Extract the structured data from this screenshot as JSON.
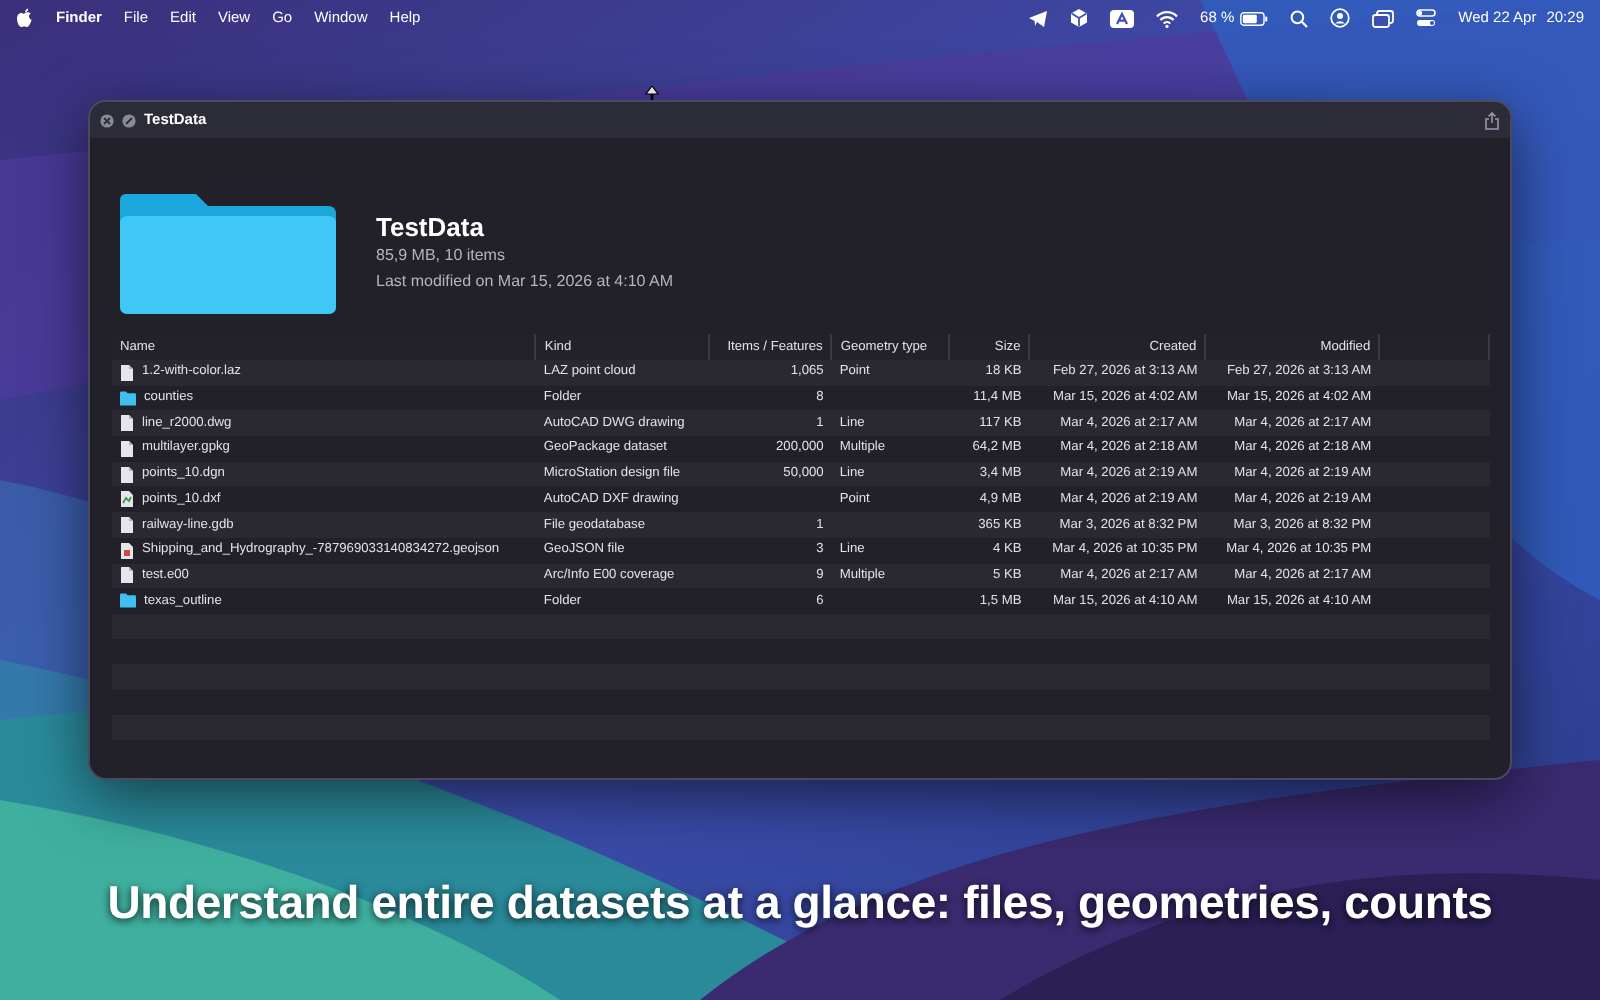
{
  "menu_bar": {
    "app": "Finder",
    "menus": [
      "File",
      "Edit",
      "View",
      "Go",
      "Window",
      "Help"
    ],
    "battery": "68 %",
    "date": "Wed 22 Apr",
    "time": "20:29"
  },
  "window": {
    "title": "TestData"
  },
  "header": {
    "title": "TestData",
    "summary": "85,9 MB, 10 items",
    "modified": "Last modified on Mar 15, 2026 at 4:10 AM"
  },
  "table": {
    "columns": [
      "Name",
      "Kind",
      "Items / Features",
      "Geometry type",
      "Size",
      "Created",
      "Modified"
    ],
    "rows": [
      {
        "kind": "file",
        "name": "1.2-with-color.laz",
        "type": "LAZ point cloud",
        "items": "1,065",
        "geometry": "Point",
        "size": "18 KB",
        "created": "Feb 27, 2026 at 3:13 AM",
        "modified": "Feb 27, 2026 at 3:13 AM"
      },
      {
        "kind": "folder",
        "name": "counties",
        "type": "Folder",
        "items": "8",
        "geometry": "",
        "size": "11,4 MB",
        "created": "Mar 15, 2026 at 4:02 AM",
        "modified": "Mar 15, 2026 at 4:02 AM"
      },
      {
        "kind": "file",
        "name": "line_r2000.dwg",
        "type": "AutoCAD DWG drawing",
        "items": "1",
        "geometry": "Line",
        "size": "117 KB",
        "created": "Mar 4, 2026 at 2:17 AM",
        "modified": "Mar 4, 2026 at 2:17 AM"
      },
      {
        "kind": "file",
        "name": "multilayer.gpkg",
        "type": "GeoPackage dataset",
        "items": "200,000",
        "geometry": "Multiple",
        "size": "64,2 MB",
        "created": "Mar 4, 2026 at 2:18 AM",
        "modified": "Mar 4, 2026 at 2:18 AM"
      },
      {
        "kind": "file",
        "name": "points_10.dgn",
        "type": "MicroStation design file",
        "items": "50,000",
        "geometry": "Line",
        "size": "3,4 MB",
        "created": "Mar 4, 2026 at 2:19 AM",
        "modified": "Mar 4, 2026 at 2:19 AM"
      },
      {
        "kind": "drawing",
        "name": "points_10.dxf",
        "type": "AutoCAD DXF drawing",
        "items": "",
        "geometry": "Point",
        "size": "4,9 MB",
        "created": "Mar 4, 2026 at 2:19 AM",
        "modified": "Mar 4, 2026 at 2:19 AM"
      },
      {
        "kind": "file",
        "name": "railway-line.gdb",
        "type": "File geodatabase",
        "items": "1",
        "geometry": "",
        "size": "365 KB",
        "created": "Mar 3, 2026 at 8:32 PM",
        "modified": "Mar 3, 2026 at 8:32 PM"
      },
      {
        "kind": "json",
        "name": "Shipping_and_Hydrography_-787969033140834272.geojson",
        "type": "GeoJSON file",
        "items": "3",
        "geometry": "Line",
        "size": "4 KB",
        "created": "Mar 4, 2026 at 10:35 PM",
        "modified": "Mar 4, 2026 at 10:35 PM"
      },
      {
        "kind": "file",
        "name": "test.e00",
        "type": "Arc/Info E00 coverage",
        "items": "9",
        "geometry": "Multiple",
        "size": "5 KB",
        "created": "Mar 4, 2026 at 2:17 AM",
        "modified": "Mar 4, 2026 at 2:17 AM"
      },
      {
        "kind": "folder",
        "name": "texas_outline",
        "type": "Folder",
        "items": "6",
        "geometry": "",
        "size": "1,5 MB",
        "created": "Mar 15, 2026 at 4:10 AM",
        "modified": "Mar 15, 2026 at 4:10 AM"
      }
    ]
  },
  "caption": "Understand entire datasets at a glance: files, geometries, counts"
}
